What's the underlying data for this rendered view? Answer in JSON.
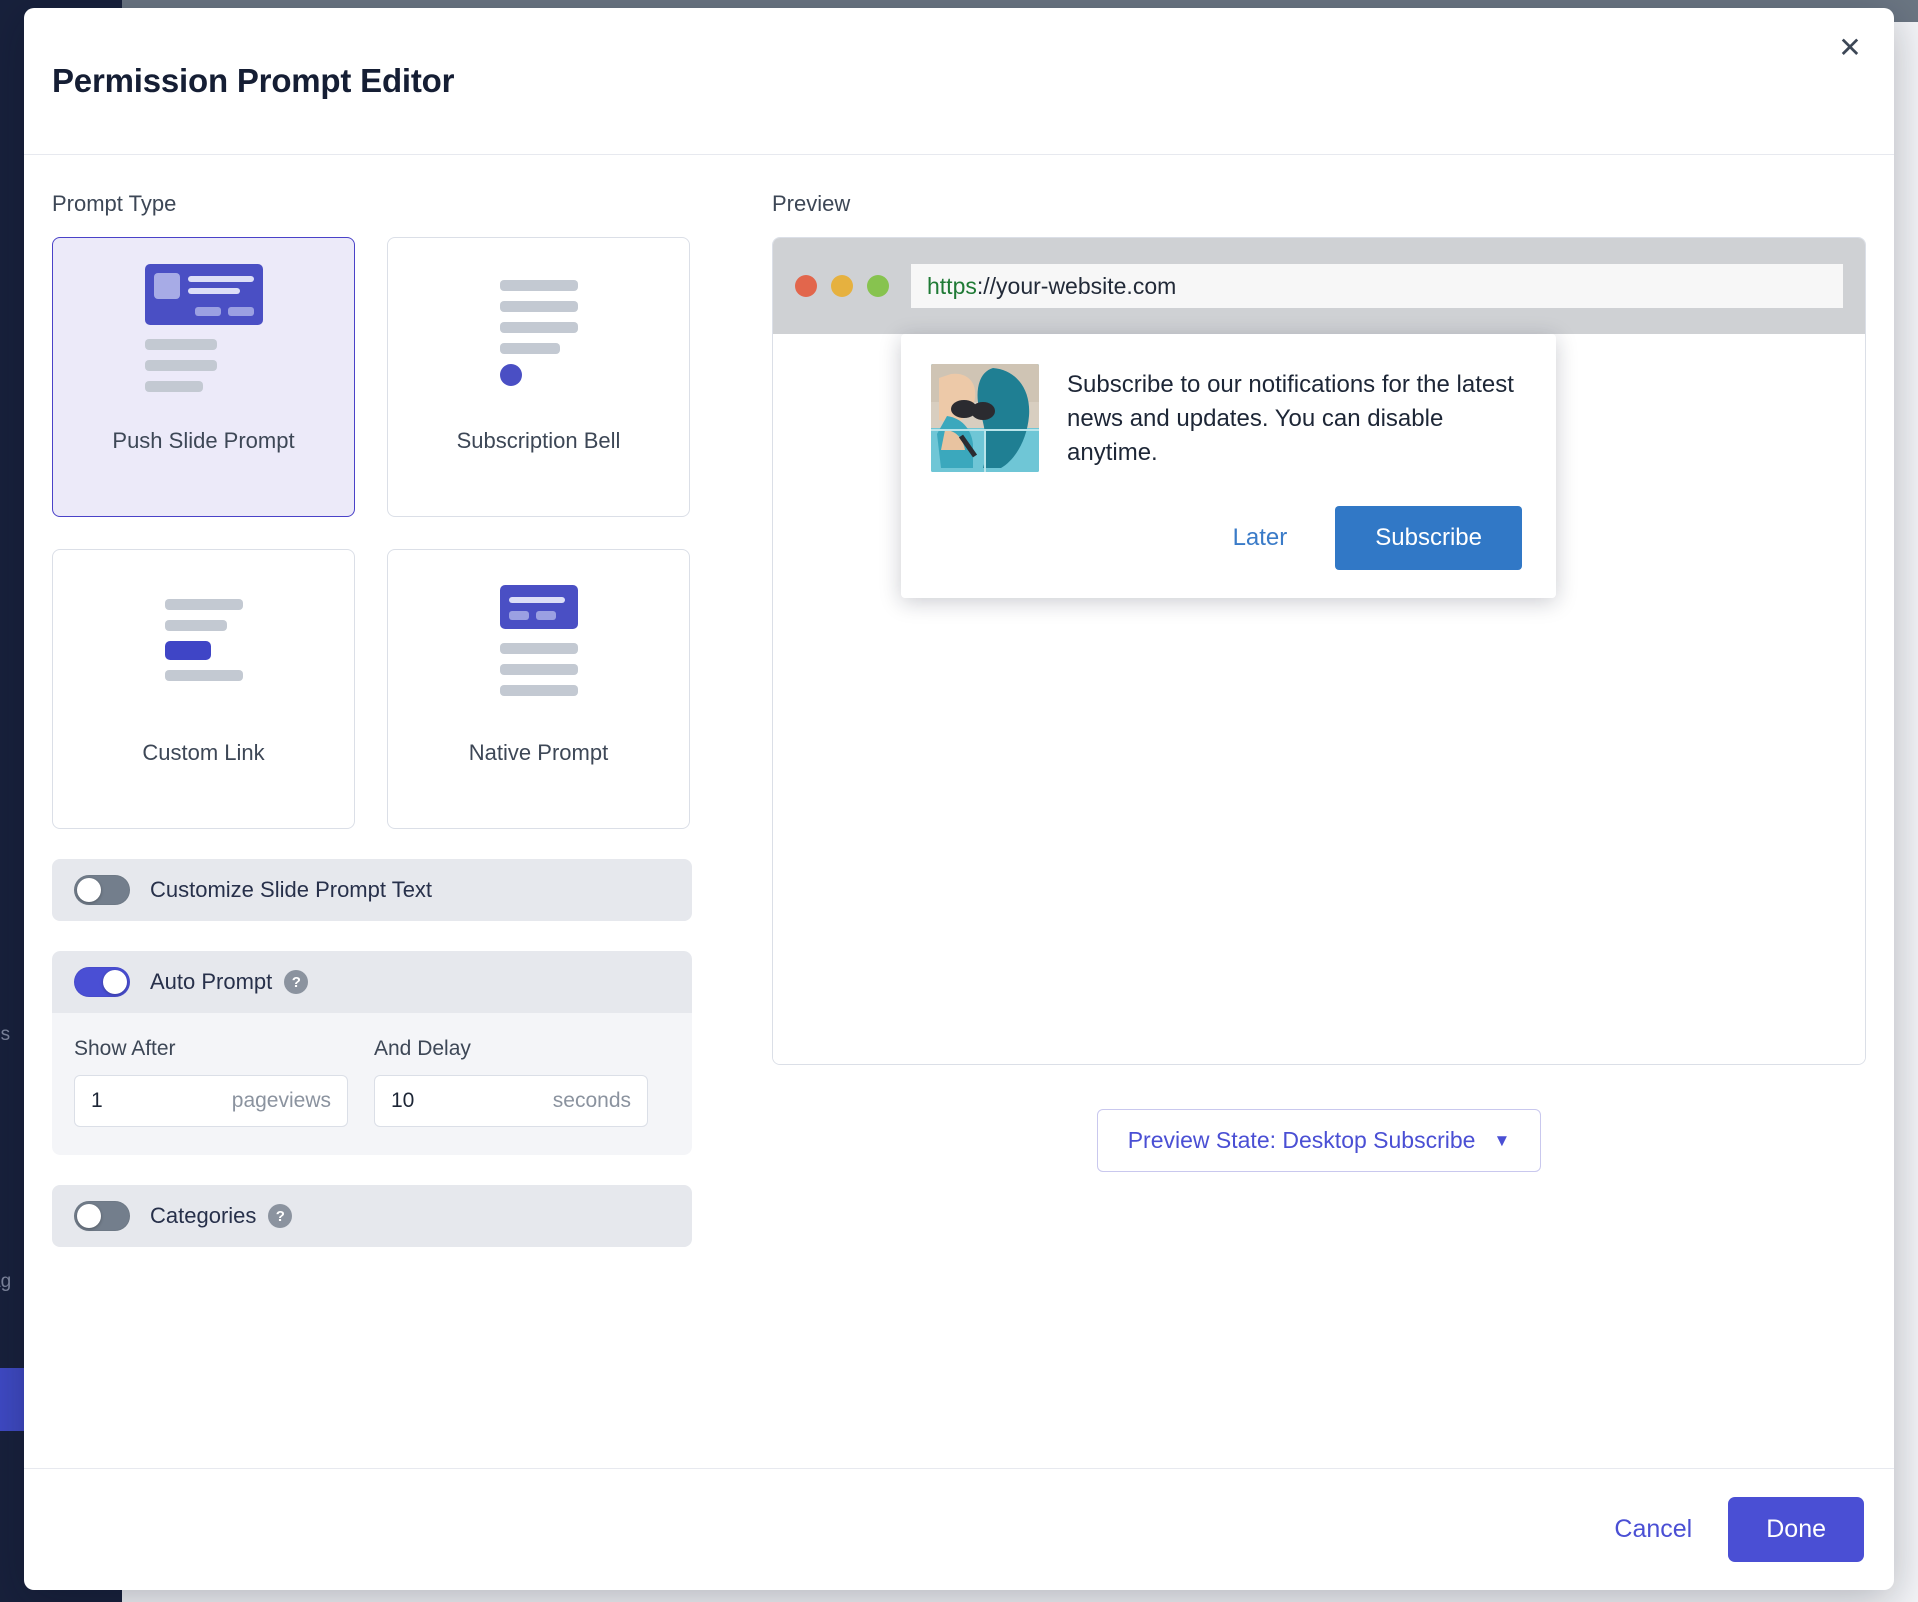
{
  "modal": {
    "title": "Permission Prompt Editor",
    "close_icon": "close-icon"
  },
  "prompt_type": {
    "section_label": "Prompt Type",
    "cards": [
      {
        "label": "Push Slide Prompt",
        "icon": "push-slide-prompt-icon",
        "selected": true
      },
      {
        "label": "Subscription Bell",
        "icon": "subscription-bell-icon",
        "selected": false
      },
      {
        "label": "Custom Link",
        "icon": "custom-link-icon",
        "selected": false
      },
      {
        "label": "Native Prompt",
        "icon": "native-prompt-icon",
        "selected": false
      }
    ]
  },
  "options": {
    "customize_text": {
      "label": "Customize Slide Prompt Text",
      "enabled": false
    },
    "auto_prompt": {
      "label": "Auto Prompt",
      "enabled": true,
      "help_icon": "?",
      "show_after": {
        "label": "Show After",
        "value": "1",
        "unit": "pageviews"
      },
      "and_delay": {
        "label": "And Delay",
        "value": "10",
        "unit": "seconds"
      }
    },
    "categories": {
      "label": "Categories",
      "enabled": false,
      "help_icon": "?"
    }
  },
  "preview": {
    "section_label": "Preview",
    "browser": {
      "url_scheme": "https",
      "url_rest": "://your-website.com"
    },
    "notification": {
      "message": "Subscribe to our notifications for the latest news and updates. You can disable anytime.",
      "later_label": "Later",
      "subscribe_label": "Subscribe",
      "thumbnail": "woman-with-teal-hair-photo"
    },
    "state_selector": {
      "label": "Preview State: Desktop Subscribe",
      "caret": "▼"
    }
  },
  "footer": {
    "cancel_label": "Cancel",
    "done_label": "Done"
  },
  "background": {
    "sidebar_text_1": "ns",
    "sidebar_text_2": "ag"
  },
  "colors": {
    "accent_purple": "#4a4fd4",
    "selected_card_bg": "#eceaf9",
    "subscribe_blue": "#3178c6",
    "toggle_off": "#737e8c",
    "sidebar_navy": "#18213c"
  }
}
